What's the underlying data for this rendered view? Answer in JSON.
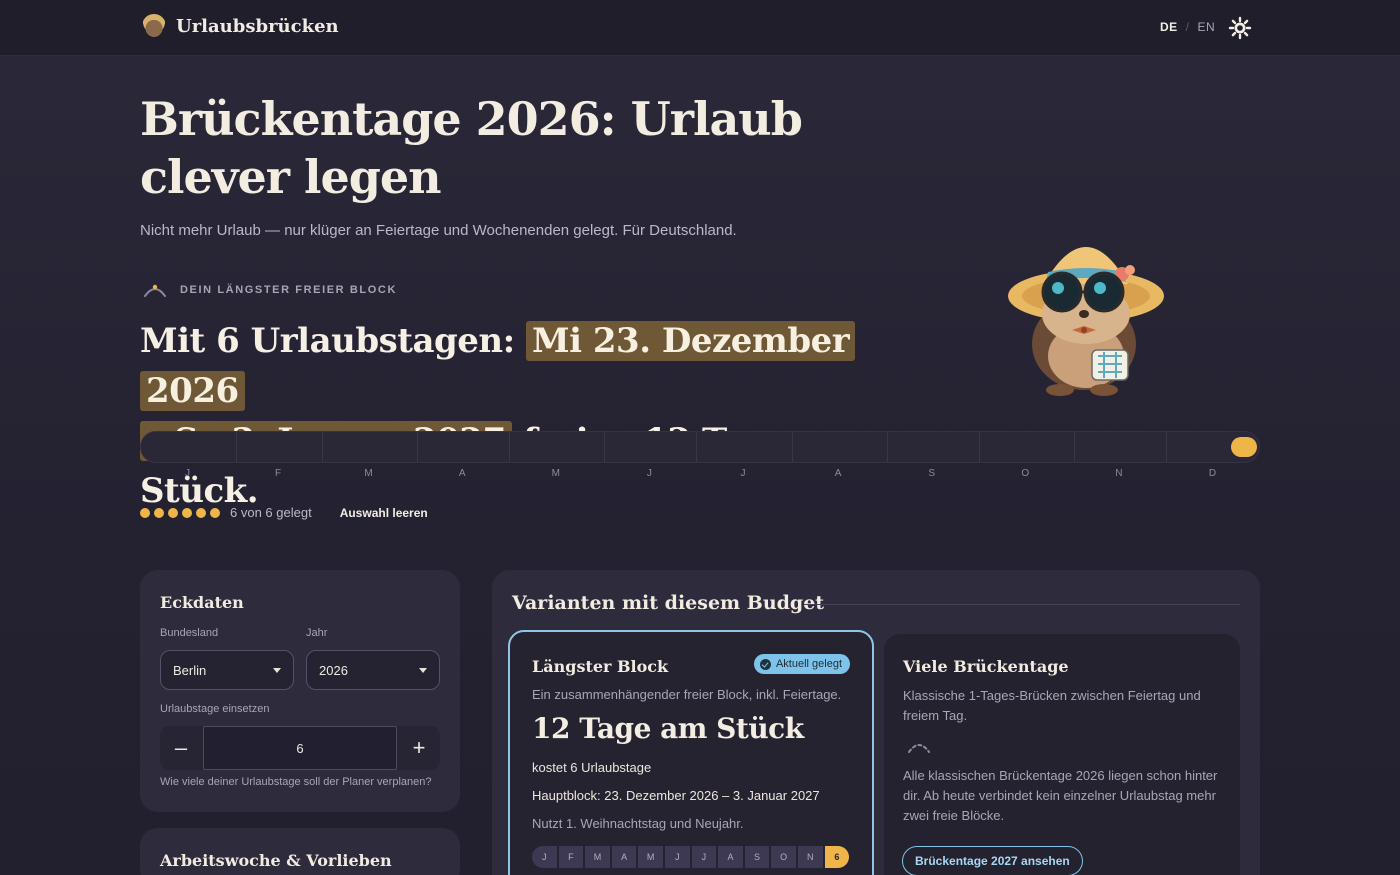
{
  "header": {
    "brand": "Urlaubsbrücken",
    "lang_de": "DE",
    "lang_sep": "/",
    "lang_en": "EN"
  },
  "hero": {
    "title": "Brückentage 2026: Urlaub clever legen",
    "subtitle": "Nicht mehr Urlaub — nur klüger an Feiertage und Wochenenden gelegt. Für Deutschland."
  },
  "longest_block": {
    "label": "DEIN LÄNGSTER FREIER BLOCK",
    "prefix": "Mit 6 Urlaubstagen: ",
    "range_part1": "Mi 23. Dezember 2026",
    "range_part2": "– So 3. Januar 2027",
    "suffix": " frei — 12 Tage am Stück."
  },
  "timeline": {
    "months": [
      "J",
      "F",
      "M",
      "A",
      "M",
      "J",
      "J",
      "A",
      "S",
      "O",
      "N",
      "D"
    ]
  },
  "selection": {
    "used": 6,
    "total": 6,
    "status_text": "6 von 6 gelegt",
    "clear_label": "Auswahl leeren"
  },
  "eckdaten": {
    "title": "Eckdaten",
    "bundesland_label": "Bundesland",
    "bundesland_value": "Berlin",
    "jahr_label": "Jahr",
    "jahr_value": "2026",
    "urlaubstage_label": "Urlaubstage einsetzen",
    "urlaubstage_value": "6",
    "minus": "–",
    "plus": "+",
    "hint": "Wie viele deiner Urlaubstage soll der Planer verplanen?"
  },
  "arbeitswoche": {
    "title": "Arbeitswoche & Vorlieben"
  },
  "variants": {
    "title": "Varianten mit diesem Budget",
    "longest": {
      "title": "Längster Block",
      "badge": "Aktuell gelegt",
      "desc": "Ein zusammenhängender freier Block, inkl. Feiertage.",
      "big": "12 Tage am Stück",
      "cost": "kostet 6 Urlaubstage",
      "main_block": "Hauptblock: 23. Dezember 2026 – 3. Januar 2027",
      "uses": "Nutzt 1. Weihnachtstag und Neujahr.",
      "mini_months": [
        "J",
        "F",
        "M",
        "A",
        "M",
        "J",
        "J",
        "A",
        "S",
        "O",
        "N"
      ],
      "mini_last": "6"
    },
    "many": {
      "title": "Viele Brückentage",
      "desc": "Klassische 1-Tages-Brücken zwischen Feiertag und freiem Tag.",
      "note": "Alle klassischen Brückentage 2026 liegen schon hinter dir. Ab heute verbindet kein einzelner Urlaubstag mehr zwei freie Blöcke.",
      "button": "Brückentage 2027 ansehen"
    }
  },
  "colors": {
    "accent": "#f0b548",
    "highlight": "#6e5836",
    "active_outline": "#8ec6e8",
    "background": "#252330"
  },
  "icons": {
    "theme": "sun-icon",
    "mascot": "hedgehog-mascot",
    "check": "check-icon"
  }
}
